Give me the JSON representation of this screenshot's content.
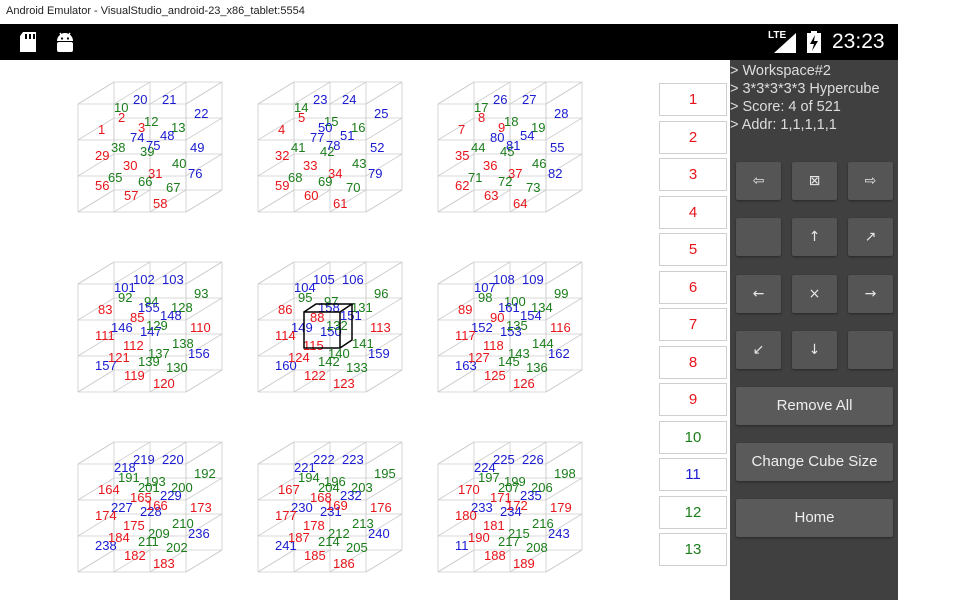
{
  "window_title": "Android Emulator - VisualStudio_android-23_x86_tablet:5554",
  "status_bar": {
    "network": "LTE",
    "clock": "23:23",
    "left_icons": [
      "sd-card-icon",
      "android-icon"
    ],
    "right_icons": [
      "signal-icon",
      "battery-charging-icon"
    ]
  },
  "colors": {
    "red": "#e8141b",
    "green": "#1a7d1a",
    "blue": "#1a1ad0",
    "panel": "#404040",
    "button": "#555555"
  },
  "info": {
    "line1": "> Workspace#2",
    "line2": "> 3*3*3*3*3 Hypercube",
    "line3": "> Score: 4 of 521",
    "line4": "> Addr: 1,1,1,1,1"
  },
  "layer_buttons": [
    {
      "label": "1",
      "color": "red"
    },
    {
      "label": "2",
      "color": "red"
    },
    {
      "label": "3",
      "color": "red"
    },
    {
      "label": "4",
      "color": "red"
    },
    {
      "label": "5",
      "color": "red"
    },
    {
      "label": "6",
      "color": "red"
    },
    {
      "label": "7",
      "color": "red"
    },
    {
      "label": "8",
      "color": "red"
    },
    {
      "label": "9",
      "color": "red"
    },
    {
      "label": "10",
      "color": "green"
    },
    {
      "label": "11",
      "color": "blue"
    },
    {
      "label": "12",
      "color": "green"
    },
    {
      "label": "13",
      "color": "green"
    }
  ],
  "nav_pad": {
    "row1": [
      "⇦",
      "⊠",
      "⇨"
    ],
    "row2": [
      "",
      "↑",
      "↗"
    ],
    "row3": [
      "←",
      "×",
      "→"
    ],
    "row4": [
      "↙",
      "↓",
      ""
    ]
  },
  "actions": {
    "remove_all": "Remove All",
    "change_size": "Change Cube Size",
    "home": "Home"
  },
  "cubes": [
    {
      "labels": [
        [
          "1",
          "red"
        ],
        [
          "2",
          "red"
        ],
        [
          "10",
          "green"
        ],
        [
          "20",
          "blue"
        ],
        [
          "21",
          "blue"
        ],
        [
          "22",
          "blue"
        ],
        [
          "12",
          "green"
        ],
        [
          "13",
          "green"
        ],
        [
          "38",
          "green"
        ],
        [
          "39",
          "green"
        ],
        [
          "48",
          "blue"
        ],
        [
          "49",
          "blue"
        ],
        [
          "29",
          "red"
        ],
        [
          "30",
          "red"
        ],
        [
          "31",
          "red"
        ],
        [
          "40",
          "green"
        ],
        [
          "56",
          "red"
        ],
        [
          "57",
          "red"
        ],
        [
          "58",
          "red"
        ],
        [
          "65",
          "green"
        ],
        [
          "66",
          "green"
        ],
        [
          "67",
          "green"
        ],
        [
          "76",
          "blue"
        ],
        [
          "74",
          "blue"
        ],
        [
          "75",
          "blue"
        ],
        [
          "3",
          "red"
        ]
      ]
    },
    {
      "labels": [
        [
          "4",
          "red"
        ],
        [
          "5",
          "red"
        ],
        [
          "14",
          "green"
        ],
        [
          "23",
          "blue"
        ],
        [
          "24",
          "blue"
        ],
        [
          "25",
          "blue"
        ],
        [
          "15",
          "green"
        ],
        [
          "16",
          "green"
        ],
        [
          "41",
          "green"
        ],
        [
          "42",
          "green"
        ],
        [
          "51",
          "blue"
        ],
        [
          "52",
          "blue"
        ],
        [
          "32",
          "red"
        ],
        [
          "33",
          "red"
        ],
        [
          "34",
          "red"
        ],
        [
          "43",
          "green"
        ],
        [
          "59",
          "red"
        ],
        [
          "60",
          "red"
        ],
        [
          "61",
          "red"
        ],
        [
          "68",
          "green"
        ],
        [
          "69",
          "green"
        ],
        [
          "70",
          "green"
        ],
        [
          "79",
          "blue"
        ],
        [
          "77",
          "blue"
        ],
        [
          "78",
          "blue"
        ],
        [
          "50",
          "blue"
        ]
      ]
    },
    {
      "labels": [
        [
          "7",
          "red"
        ],
        [
          "8",
          "red"
        ],
        [
          "17",
          "green"
        ],
        [
          "26",
          "blue"
        ],
        [
          "27",
          "blue"
        ],
        [
          "28",
          "blue"
        ],
        [
          "18",
          "green"
        ],
        [
          "19",
          "green"
        ],
        [
          "44",
          "green"
        ],
        [
          "45",
          "green"
        ],
        [
          "54",
          "blue"
        ],
        [
          "55",
          "blue"
        ],
        [
          "35",
          "red"
        ],
        [
          "36",
          "red"
        ],
        [
          "37",
          "red"
        ],
        [
          "46",
          "green"
        ],
        [
          "62",
          "red"
        ],
        [
          "63",
          "red"
        ],
        [
          "64",
          "red"
        ],
        [
          "71",
          "green"
        ],
        [
          "72",
          "green"
        ],
        [
          "73",
          "green"
        ],
        [
          "82",
          "blue"
        ],
        [
          "80",
          "blue"
        ],
        [
          "81",
          "blue"
        ],
        [
          "9",
          "red"
        ]
      ]
    },
    {
      "labels": [
        [
          "83",
          "red"
        ],
        [
          "92",
          "green"
        ],
        [
          "101",
          "blue"
        ],
        [
          "102",
          "blue"
        ],
        [
          "103",
          "blue"
        ],
        [
          "93",
          "green"
        ],
        [
          "94",
          "green"
        ],
        [
          "128",
          "green"
        ],
        [
          "146",
          "blue"
        ],
        [
          "147",
          "blue"
        ],
        [
          "148",
          "blue"
        ],
        [
          "110",
          "red"
        ],
        [
          "111",
          "red"
        ],
        [
          "112",
          "red"
        ],
        [
          "137",
          "green"
        ],
        [
          "138",
          "green"
        ],
        [
          "157",
          "blue"
        ],
        [
          "119",
          "red"
        ],
        [
          "120",
          "red"
        ],
        [
          "121",
          "red"
        ],
        [
          "139",
          "green"
        ],
        [
          "130",
          "green"
        ],
        [
          "156",
          "blue"
        ],
        [
          "85",
          "red"
        ],
        [
          "129",
          "green"
        ],
        [
          "155",
          "blue"
        ]
      ]
    },
    {
      "labels": [
        [
          "86",
          "red"
        ],
        [
          "95",
          "green"
        ],
        [
          "104",
          "blue"
        ],
        [
          "105",
          "blue"
        ],
        [
          "106",
          "blue"
        ],
        [
          "96",
          "green"
        ],
        [
          "97",
          "green"
        ],
        [
          "131",
          "green"
        ],
        [
          "149",
          "blue"
        ],
        [
          "150",
          "blue"
        ],
        [
          "151",
          "blue"
        ],
        [
          "113",
          "red"
        ],
        [
          "114",
          "red"
        ],
        [
          "115",
          "red"
        ],
        [
          "140",
          "green"
        ],
        [
          "141",
          "green"
        ],
        [
          "160",
          "blue"
        ],
        [
          "122",
          "red"
        ],
        [
          "123",
          "red"
        ],
        [
          "124",
          "red"
        ],
        [
          "142",
          "green"
        ],
        [
          "133",
          "green"
        ],
        [
          "159",
          "blue"
        ],
        [
          "88",
          "red"
        ],
        [
          "132",
          "green"
        ],
        [
          "158",
          "blue"
        ]
      ]
    },
    {
      "labels": [
        [
          "89",
          "red"
        ],
        [
          "98",
          "green"
        ],
        [
          "107",
          "blue"
        ],
        [
          "108",
          "blue"
        ],
        [
          "109",
          "blue"
        ],
        [
          "99",
          "green"
        ],
        [
          "100",
          "green"
        ],
        [
          "134",
          "green"
        ],
        [
          "152",
          "blue"
        ],
        [
          "153",
          "blue"
        ],
        [
          "154",
          "blue"
        ],
        [
          "116",
          "red"
        ],
        [
          "117",
          "red"
        ],
        [
          "118",
          "red"
        ],
        [
          "143",
          "green"
        ],
        [
          "144",
          "green"
        ],
        [
          "163",
          "blue"
        ],
        [
          "125",
          "red"
        ],
        [
          "126",
          "red"
        ],
        [
          "127",
          "red"
        ],
        [
          "145",
          "green"
        ],
        [
          "136",
          "green"
        ],
        [
          "162",
          "blue"
        ],
        [
          "90",
          "red"
        ],
        [
          "135",
          "green"
        ],
        [
          "161",
          "blue"
        ]
      ]
    },
    {
      "labels": [
        [
          "164",
          "red"
        ],
        [
          "191",
          "green"
        ],
        [
          "218",
          "blue"
        ],
        [
          "219",
          "blue"
        ],
        [
          "220",
          "blue"
        ],
        [
          "192",
          "green"
        ],
        [
          "193",
          "green"
        ],
        [
          "200",
          "green"
        ],
        [
          "227",
          "blue"
        ],
        [
          "228",
          "blue"
        ],
        [
          "229",
          "blue"
        ],
        [
          "173",
          "red"
        ],
        [
          "174",
          "red"
        ],
        [
          "175",
          "red"
        ],
        [
          "209",
          "green"
        ],
        [
          "210",
          "green"
        ],
        [
          "238",
          "blue"
        ],
        [
          "182",
          "red"
        ],
        [
          "183",
          "red"
        ],
        [
          "184",
          "red"
        ],
        [
          "211",
          "green"
        ],
        [
          "202",
          "green"
        ],
        [
          "236",
          "blue"
        ],
        [
          "165",
          "red"
        ],
        [
          "166",
          "red"
        ],
        [
          "201",
          "green"
        ]
      ]
    },
    {
      "labels": [
        [
          "167",
          "red"
        ],
        [
          "194",
          "green"
        ],
        [
          "221",
          "blue"
        ],
        [
          "222",
          "blue"
        ],
        [
          "223",
          "blue"
        ],
        [
          "195",
          "green"
        ],
        [
          "196",
          "green"
        ],
        [
          "203",
          "green"
        ],
        [
          "230",
          "blue"
        ],
        [
          "231",
          "blue"
        ],
        [
          "232",
          "blue"
        ],
        [
          "176",
          "red"
        ],
        [
          "177",
          "red"
        ],
        [
          "178",
          "red"
        ],
        [
          "212",
          "green"
        ],
        [
          "213",
          "green"
        ],
        [
          "241",
          "blue"
        ],
        [
          "185",
          "red"
        ],
        [
          "186",
          "red"
        ],
        [
          "187",
          "red"
        ],
        [
          "214",
          "green"
        ],
        [
          "205",
          "green"
        ],
        [
          "240",
          "blue"
        ],
        [
          "168",
          "red"
        ],
        [
          "169",
          "red"
        ],
        [
          "204",
          "green"
        ]
      ]
    },
    {
      "labels": [
        [
          "170",
          "red"
        ],
        [
          "197",
          "green"
        ],
        [
          "224",
          "blue"
        ],
        [
          "225",
          "blue"
        ],
        [
          "226",
          "blue"
        ],
        [
          "198",
          "green"
        ],
        [
          "199",
          "green"
        ],
        [
          "206",
          "green"
        ],
        [
          "233",
          "blue"
        ],
        [
          "234",
          "blue"
        ],
        [
          "235",
          "blue"
        ],
        [
          "179",
          "red"
        ],
        [
          "180",
          "red"
        ],
        [
          "181",
          "red"
        ],
        [
          "215",
          "green"
        ],
        [
          "216",
          "green"
        ],
        [
          "11",
          "blue"
        ],
        [
          "188",
          "red"
        ],
        [
          "189",
          "red"
        ],
        [
          "190",
          "red"
        ],
        [
          "217",
          "green"
        ],
        [
          "208",
          "green"
        ],
        [
          "243",
          "blue"
        ],
        [
          "171",
          "red"
        ],
        [
          "172",
          "red"
        ],
        [
          "207",
          "green"
        ]
      ]
    }
  ]
}
